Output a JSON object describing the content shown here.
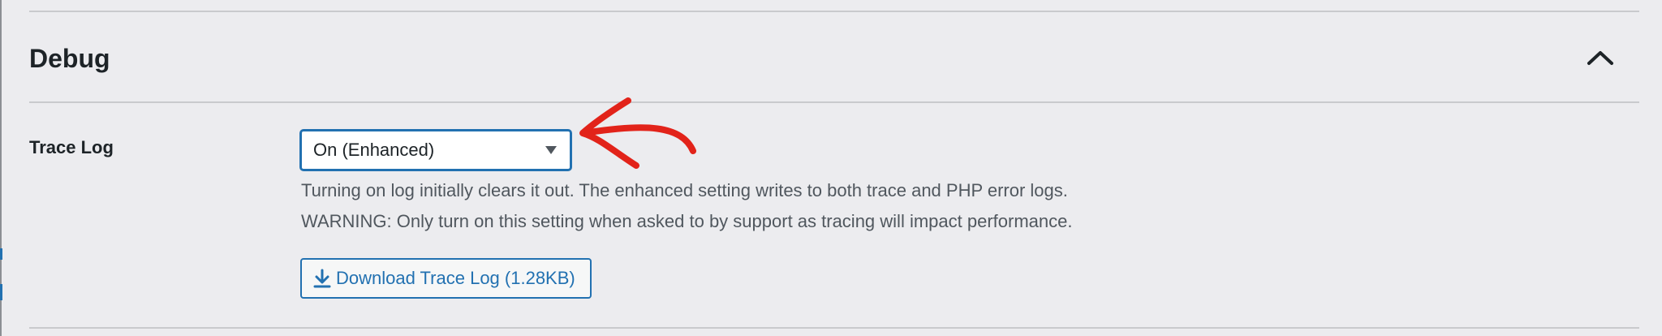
{
  "section": {
    "title": "Debug",
    "toggle_icon": "chevron-up-icon"
  },
  "trace_log": {
    "label": "Trace Log",
    "select_value": "On (Enhanced)",
    "caret_icon": "caret-down-icon",
    "description_1": "Turning on log initially clears it out. The enhanced setting writes to both trace and PHP error logs.",
    "description_2": "WARNING: Only turn on this setting when asked to by support as tracing will impact performance.",
    "download_label": "Download Trace Log (1.28KB)",
    "download_icon": "download-icon"
  },
  "annotation": {
    "icon": "red-arrow-icon",
    "color": "#e2231a"
  },
  "colors": {
    "accent": "#2271b1",
    "background": "#ececef",
    "text": "#1d2327",
    "muted_text": "#50575e"
  }
}
